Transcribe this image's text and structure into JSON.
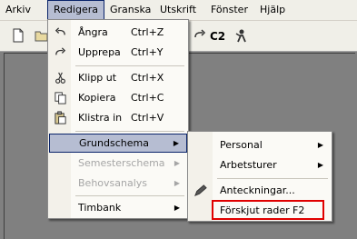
{
  "menubar": {
    "items": [
      "Arkiv",
      "Redigera",
      "Granska",
      "Utskrift",
      "Fönster",
      "Hjälp"
    ]
  },
  "toolbar": {
    "c2_label": "C2"
  },
  "edit_menu": {
    "items": [
      {
        "label": "Ångra",
        "shortcut": "Ctrl+Z",
        "icon": "undo-icon"
      },
      {
        "label": "Upprepa",
        "shortcut": "Ctrl+Y",
        "icon": "redo-icon"
      },
      {
        "label": "Klipp ut",
        "shortcut": "Ctrl+X",
        "icon": "scissors-icon"
      },
      {
        "label": "Kopiera",
        "shortcut": "Ctrl+C",
        "icon": "copy-icon"
      },
      {
        "label": "Klistra in",
        "shortcut": "Ctrl+V",
        "icon": "paste-icon"
      },
      {
        "label": "Grundschema",
        "submenu": true,
        "state": "highlighted"
      },
      {
        "label": "Semesterschema",
        "submenu": true,
        "state": "disabled"
      },
      {
        "label": "Behovsanalys",
        "submenu": true,
        "state": "disabled"
      },
      {
        "label": "Timbank",
        "submenu": true
      }
    ]
  },
  "submenu": {
    "items": [
      {
        "label": "Personal",
        "submenu": true
      },
      {
        "label": "Arbetsturer",
        "submenu": true
      },
      {
        "label": "Anteckningar...",
        "icon": "pencil-icon"
      },
      {
        "label": "Förskjut rader",
        "shortcut": "F2",
        "state": "outlined"
      }
    ]
  },
  "colors": {
    "highlight": "#b6bdd2",
    "outline": "#e00000",
    "workspace": "#808080"
  }
}
